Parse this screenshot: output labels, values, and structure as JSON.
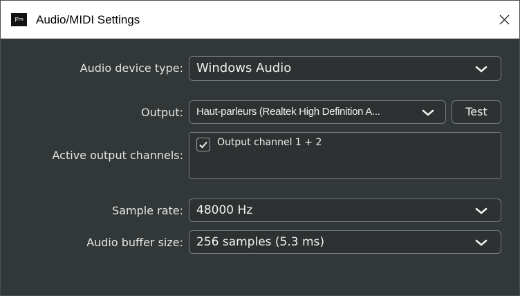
{
  "window": {
    "app_logo_text": "JFm",
    "title": "Audio/MIDI Settings"
  },
  "fields": {
    "device_type": {
      "label": "Audio device type:",
      "value": "Windows Audio"
    },
    "output": {
      "label": "Output:",
      "value": "Haut-parleurs (Realtek High Definition A...",
      "test_button": "Test"
    },
    "active_output_channels": {
      "label": "Active output channels:",
      "channels": [
        {
          "name": "Output channel 1 + 2",
          "checked": true
        }
      ]
    },
    "sample_rate": {
      "label": "Sample rate:",
      "value": "48000 Hz"
    },
    "buffer_size": {
      "label": "Audio buffer size:",
      "value": "256 samples (5.3 ms)"
    }
  },
  "colors": {
    "panel_background": "#323737",
    "control_background": "#2d3131",
    "control_border": "#777c7c",
    "text": "#f1f1f1"
  }
}
